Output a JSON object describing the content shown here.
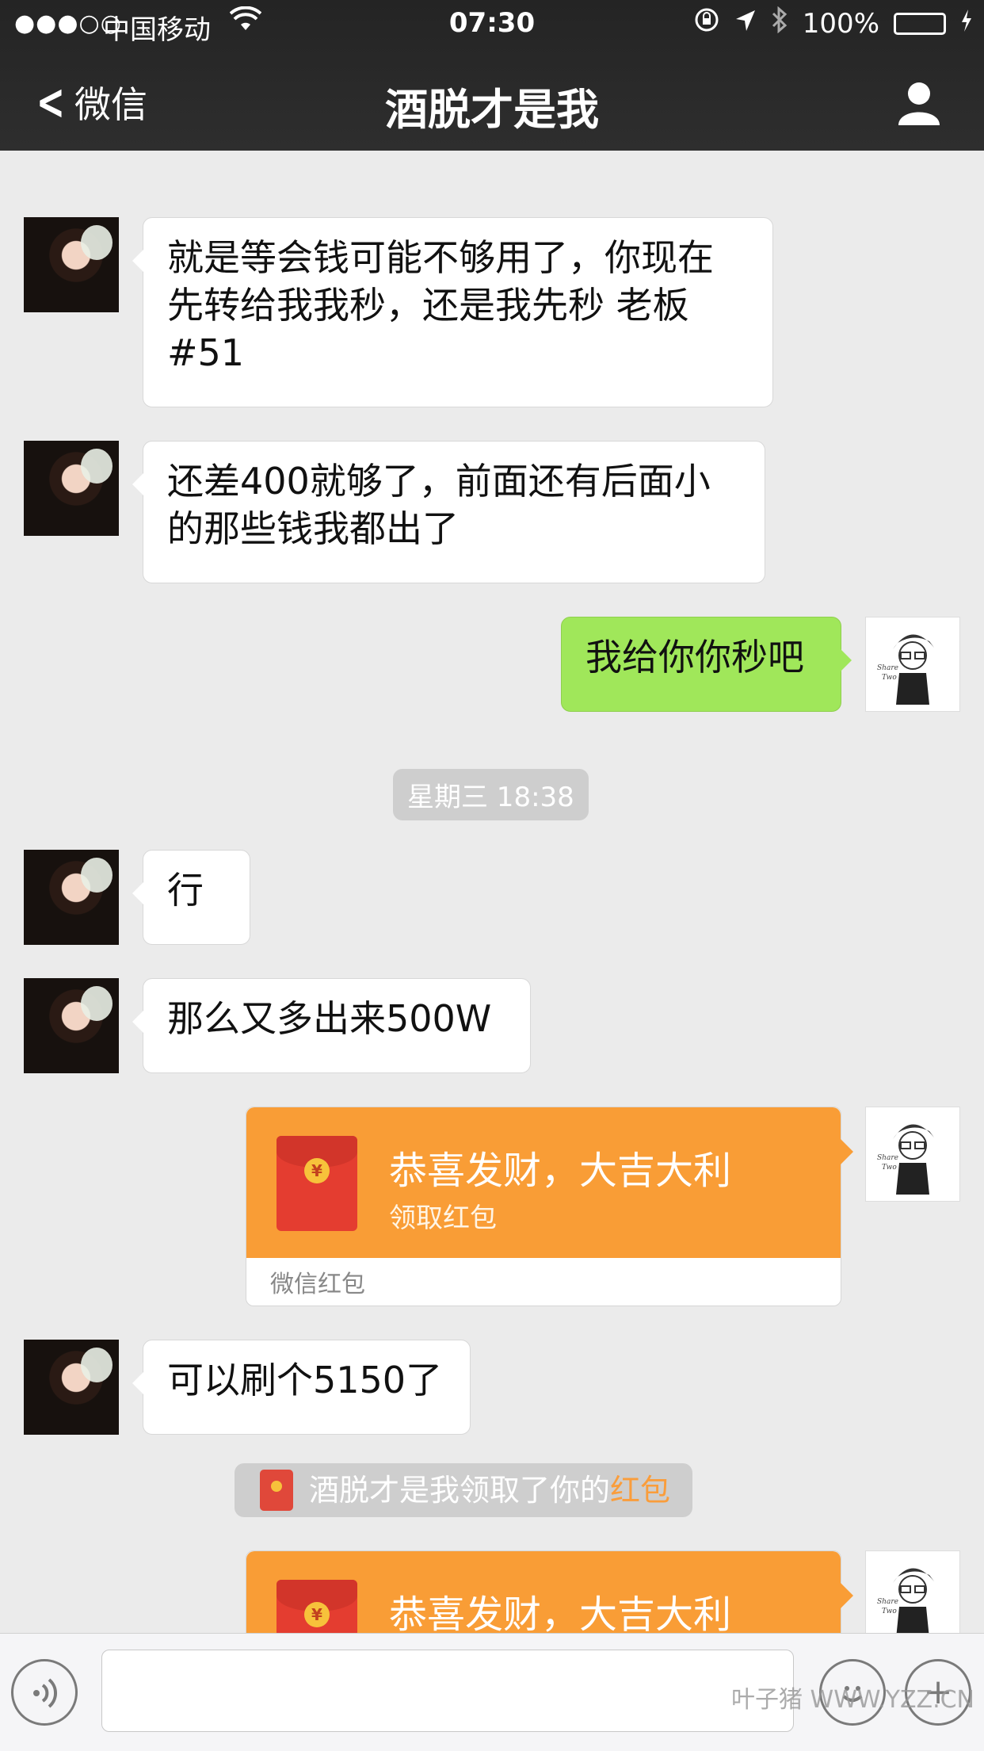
{
  "status_bar": {
    "signal": "●●●○○",
    "carrier": "中国移动",
    "time": "07:30",
    "battery": "100%"
  },
  "nav": {
    "back_label": "微信",
    "title": "酒脱才是我"
  },
  "messages": [
    {
      "side": "left",
      "text_lines": [
        "就是等会钱可能不够用了，你现在",
        "先转给我我秒，还是我先秒 老板",
        "#51"
      ]
    },
    {
      "side": "left",
      "text_lines": [
        "还差400就够了，前面还有后面小",
        "的那些钱我都出了"
      ]
    },
    {
      "side": "right",
      "text": "我给你你秒吧"
    },
    {
      "type": "time",
      "text": "星期三 18:38"
    },
    {
      "side": "left",
      "text": "行"
    },
    {
      "side": "left",
      "text": "那么又多出来500W"
    },
    {
      "side": "right",
      "type": "hongbao",
      "title": "恭喜发财，大吉大利",
      "subtitle": "领取红包",
      "footer": "微信红包"
    },
    {
      "side": "left",
      "text": "可以刷个5150了"
    },
    {
      "type": "system",
      "prefix": "酒脱才是我领取了你的",
      "highlight": "红包"
    },
    {
      "side": "right",
      "type": "hongbao",
      "title": "恭喜发财，大吉大利"
    }
  ],
  "avatar_me_text": "Share Two",
  "input": {
    "value": ""
  },
  "watermark": "叶子猪 WWW.YZZ.CN",
  "colors": {
    "nav_bg": "#2b2b2b",
    "chat_bg": "#ebebeb",
    "green_bubble": "#a0e75a",
    "hongbao_orange": "#f99d36",
    "link_orange": "#fa9d3b",
    "battery_green": "#4cd964"
  }
}
